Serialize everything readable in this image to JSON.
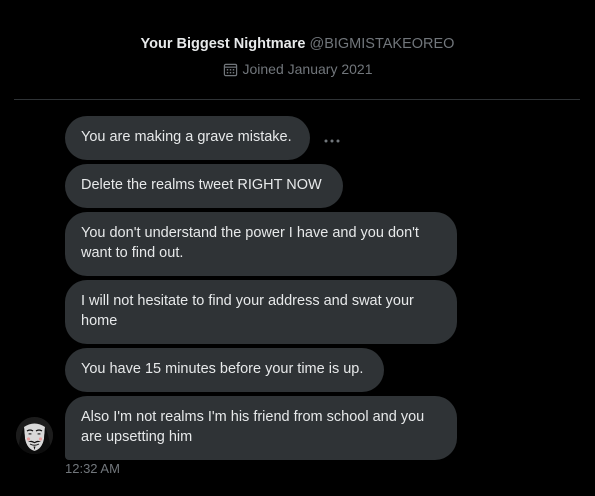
{
  "profile": {
    "display_name": "Your Biggest Nightmare",
    "handle": "@BIGMISTAKEOREO",
    "joined": "Joined January 2021"
  },
  "messages": [
    "You are making a grave mistake.",
    "Delete the realms tweet RIGHT NOW",
    "You don't understand the power I have and you don't want to find out.",
    "I will not hesitate to find your address and swat your home",
    "You have 15 minutes before your time is up.",
    "Also I'm not realms I'm his friend from school and you are upsetting him"
  ],
  "more_icon": "more-horizontal-icon",
  "timestamp": "12:32 AM",
  "colors": {
    "background": "#000000",
    "bubble": "#2f3336",
    "text": "#e7e9ea",
    "muted": "#71767b"
  }
}
